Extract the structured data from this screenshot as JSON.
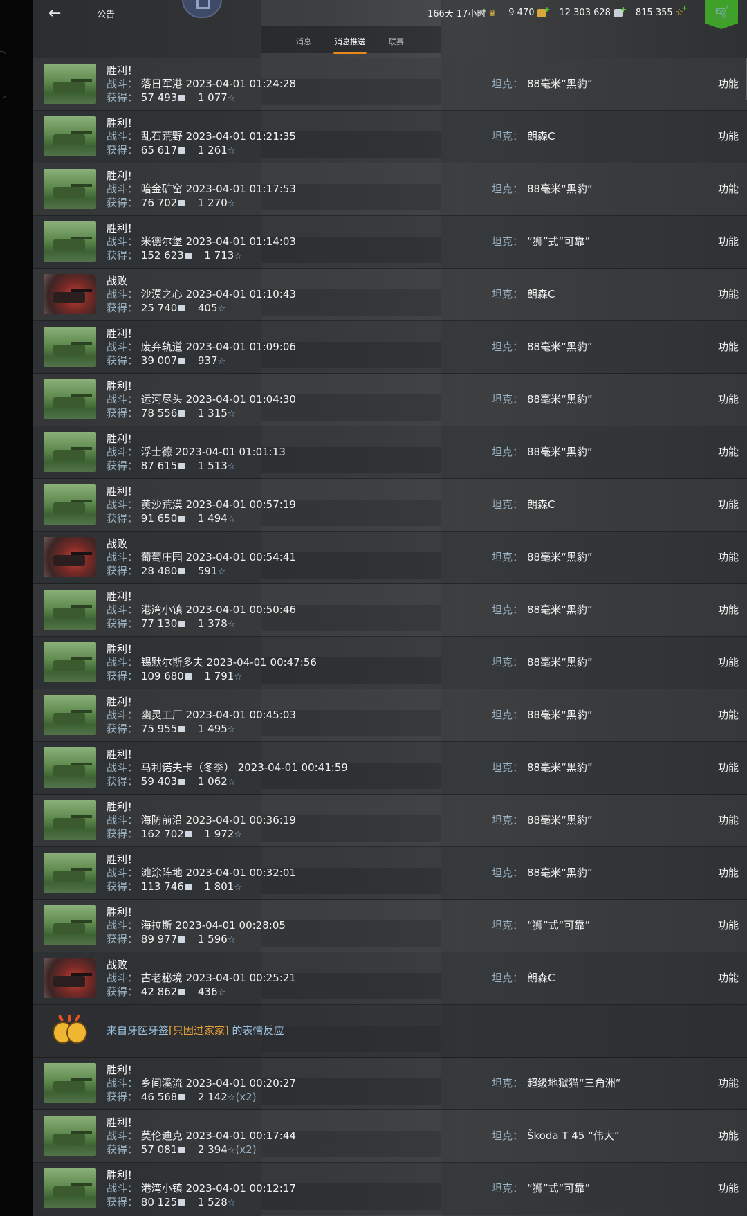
{
  "header": {
    "back_label": "←",
    "title": "公告",
    "premium": "166天 17小时",
    "gold": "9 470",
    "credits": "12 303 628",
    "free_xp": "815 355",
    "shop_label": "🛒"
  },
  "tabs": [
    {
      "label": "消息",
      "active": false
    },
    {
      "label": "消息推送",
      "active": true
    },
    {
      "label": "联赛",
      "active": false
    }
  ],
  "labels": {
    "battle": "战斗：",
    "earned": "获得：",
    "tank": "坦克：",
    "func": "功能"
  },
  "rows": [
    {
      "result": "胜利！",
      "win": true,
      "map": "落日军港",
      "time": "2023-04-01 01:24:28",
      "credits": "57 493",
      "xp": "1 077",
      "mult": "",
      "tank": "88毫米“黑豹”"
    },
    {
      "result": "胜利！",
      "win": true,
      "map": "乱石荒野",
      "time": "2023-04-01 01:21:35",
      "credits": "65 617",
      "xp": "1 261",
      "mult": "",
      "tank": "朗森C"
    },
    {
      "result": "胜利！",
      "win": true,
      "map": "暗金矿窑",
      "time": "2023-04-01 01:17:53",
      "credits": "76 702",
      "xp": "1 270",
      "mult": "",
      "tank": "88毫米“黑豹”"
    },
    {
      "result": "胜利！",
      "win": true,
      "map": "米德尔堡",
      "time": "2023-04-01 01:14:03",
      "credits": "152 623",
      "xp": "1 713",
      "mult": "",
      "tank": "“狮”式“可靠”"
    },
    {
      "result": "战败",
      "win": false,
      "map": "沙漠之心",
      "time": "2023-04-01 01:10:43",
      "credits": "25 740",
      "xp": "405",
      "mult": "",
      "tank": "朗森C"
    },
    {
      "result": "胜利！",
      "win": true,
      "map": "废弃轨道",
      "time": "2023-04-01 01:09:06",
      "credits": "39 007",
      "xp": "937",
      "mult": "",
      "tank": "88毫米“黑豹”"
    },
    {
      "result": "胜利！",
      "win": true,
      "map": "运河尽头",
      "time": "2023-04-01 01:04:30",
      "credits": "78 556",
      "xp": "1 315",
      "mult": "",
      "tank": "88毫米“黑豹”"
    },
    {
      "result": "胜利！",
      "win": true,
      "map": "浮士德",
      "time": "2023-04-01 01:01:13",
      "credits": "87 615",
      "xp": "1 513",
      "mult": "",
      "tank": "88毫米“黑豹”"
    },
    {
      "result": "胜利！",
      "win": true,
      "map": "黄沙荒漠",
      "time": "2023-04-01 00:57:19",
      "credits": "91 650",
      "xp": "1 494",
      "mult": "",
      "tank": "朗森C"
    },
    {
      "result": "战败",
      "win": false,
      "map": "葡萄庄园",
      "time": "2023-04-01 00:54:41",
      "credits": "28 480",
      "xp": "591",
      "mult": "",
      "tank": "88毫米“黑豹”"
    },
    {
      "result": "胜利！",
      "win": true,
      "map": "港湾小镇",
      "time": "2023-04-01 00:50:46",
      "credits": "77 130",
      "xp": "1 378",
      "mult": "",
      "tank": "88毫米“黑豹”"
    },
    {
      "result": "胜利！",
      "win": true,
      "map": "锡默尔斯多夫",
      "time": "2023-04-01 00:47:56",
      "credits": "109 680",
      "xp": "1 791",
      "mult": "",
      "tank": "88毫米“黑豹”"
    },
    {
      "result": "胜利！",
      "win": true,
      "map": "幽灵工厂",
      "time": "2023-04-01 00:45:03",
      "credits": "75 955",
      "xp": "1 495",
      "mult": "",
      "tank": "88毫米“黑豹”"
    },
    {
      "result": "胜利！",
      "win": true,
      "map": "马利诺夫卡（冬季）",
      "time": "2023-04-01 00:41:59",
      "credits": "59 403",
      "xp": "1 062",
      "mult": "",
      "tank": "88毫米“黑豹”"
    },
    {
      "result": "胜利！",
      "win": true,
      "map": "海防前沿",
      "time": "2023-04-01 00:36:19",
      "credits": "162 702",
      "xp": "1 972",
      "mult": "",
      "tank": "88毫米“黑豹”"
    },
    {
      "result": "胜利！",
      "win": true,
      "map": "滩涂阵地",
      "time": "2023-04-01 00:32:01",
      "credits": "113 746",
      "xp": "1 801",
      "mult": "",
      "tank": "88毫米“黑豹”"
    },
    {
      "result": "胜利！",
      "win": true,
      "map": "海拉斯",
      "time": "2023-04-01 00:28:05",
      "credits": "89 977",
      "xp": "1 596",
      "mult": "",
      "tank": "“狮”式“可靠”"
    },
    {
      "result": "战败",
      "win": false,
      "map": "古老秘境",
      "time": "2023-04-01 00:25:21",
      "credits": "42 862",
      "xp": "436",
      "mult": "",
      "tank": "朗森C"
    }
  ],
  "notice": {
    "prefix": "来自牙医牙签",
    "clan": "[只因过家家]",
    "suffix": " 的表情反应"
  },
  "rows2": [
    {
      "result": "胜利！",
      "win": true,
      "map": "乡间溪流",
      "time": "2023-04-01 00:20:27",
      "credits": "46 568",
      "xp": "2 142",
      "mult": "(x2)",
      "tank": "超级地狱猫“三角洲”"
    },
    {
      "result": "胜利！",
      "win": true,
      "map": "莫伦迪克",
      "time": "2023-04-01 00:17:44",
      "credits": "57 081",
      "xp": "2 394",
      "mult": "(x2)",
      "tank": "Škoda T 45 “伟大”"
    },
    {
      "result": "胜利！",
      "win": true,
      "map": "港湾小镇",
      "time": "2023-04-01 00:12:17",
      "credits": "80 125",
      "xp": "1 528",
      "mult": "",
      "tank": "“狮”式“可靠”"
    }
  ]
}
